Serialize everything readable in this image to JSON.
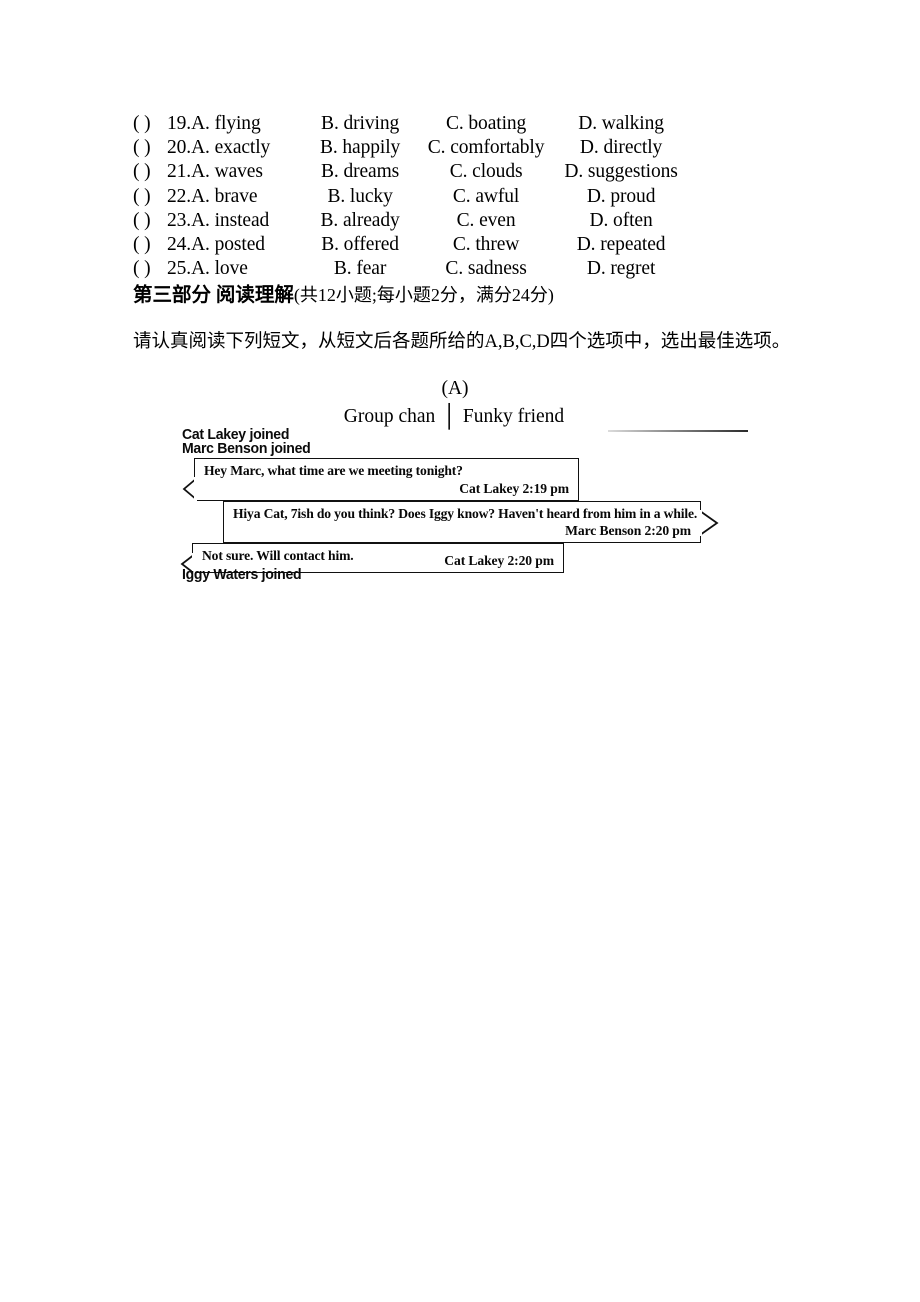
{
  "questions": {
    "items": [
      {
        "marker": "(    )",
        "number": "19.",
        "a": "A. flying",
        "b": "B. driving",
        "c": "C. boating",
        "d": "D. walking"
      },
      {
        "marker": "(    )",
        "number": "20.",
        "a": "A. exactly",
        "b": "B. happily",
        "c": "C. comfortably",
        "d": "D. directly"
      },
      {
        "marker": "(    )",
        "number": "21.",
        "a": "A. waves",
        "b": "B. dreams",
        "c": "C. clouds",
        "d": "D. suggestions"
      },
      {
        "marker": "(    )",
        "number": "22.",
        "a": "A. brave",
        "b": "B. lucky",
        "c": "C. awful",
        "d": "D. proud"
      },
      {
        "marker": "(    )",
        "number": "23.",
        "a": "A. instead",
        "b": "B. already",
        "c": "C. even",
        "d": "D. often"
      },
      {
        "marker": "(    )",
        "number": "24.",
        "a": "A. posted",
        "b": "B. offered",
        "c": "C. threw",
        "d": "D. repeated"
      },
      {
        "marker": "(    )",
        "number": "25.",
        "a": "A. love",
        "b": "B. fear",
        "c": "C. sadness",
        "d": "D. regret"
      }
    ]
  },
  "section": {
    "heading_bold": "第三部分  阅读理解",
    "heading_rest": "(共12小题;每小题2分，满分24分)",
    "instruction": "请认真阅读下列短文，从短文后各题所给的A,B,C,D四个选项中，选出最佳选项。"
  },
  "passage": {
    "label": "(A)",
    "chat_app_name": "Group chan",
    "chat_divider": "│",
    "chat_room_name": "Funky friend"
  },
  "chat": {
    "joined_events": [
      "Cat Lakey joined",
      "Marc Benson joined",
      "Iggy Waters joined"
    ],
    "messages": [
      {
        "text": "Hey Marc, what time are we meeting tonight?",
        "sender": "Cat Lakey",
        "time": "2:19 pm",
        "meta": "Cat Lakey 2:19 pm",
        "side": "left"
      },
      {
        "text": "Hiya Cat, 7ish do you think? Does Iggy know? Haven't heard from him in a  while.",
        "sender": "Marc Benson",
        "time": "2:20 pm",
        "meta": "Marc Benson 2:20 pm",
        "side": "right"
      },
      {
        "text": "Not sure. Will contact him.",
        "sender": "Cat Lakey",
        "time": "2:20 pm",
        "meta": "Cat Lakey 2:20 pm",
        "side": "left"
      }
    ]
  },
  "colors": {
    "ink": "#000000",
    "paper": "#ffffff",
    "bubble_border": "#111111"
  }
}
